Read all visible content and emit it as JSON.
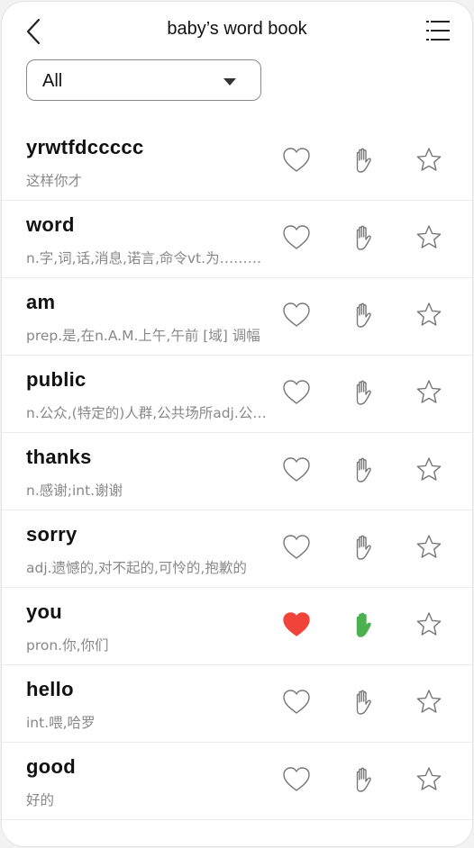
{
  "header": {
    "title": "baby’s word book",
    "back_icon": "chevron-left-icon",
    "menu_icon": "list-menu-icon"
  },
  "filter": {
    "selected": "All"
  },
  "colors": {
    "liked_heart": "#f2433b",
    "known_hand": "#4caf50",
    "outline": "#777777"
  },
  "words": [
    {
      "word": "yrwtfdccccc",
      "meaning": "这样你才",
      "liked": false,
      "known": false,
      "starred": false
    },
    {
      "word": "word",
      "meaning": "n.字,词,话,消息,诺言,命令vt.为……措辞",
      "liked": false,
      "known": false,
      "starred": false
    },
    {
      "word": "am",
      "meaning": "prep.是,在n.A.M.上午,午前 [域] 调幅",
      "liked": false,
      "known": false,
      "starred": false
    },
    {
      "word": "public",
      "meaning": "n.公众,(特定的)人群,公共场所adj.公共的",
      "liked": false,
      "known": false,
      "starred": false
    },
    {
      "word": "thanks",
      "meaning": "n.感谢;int.谢谢",
      "liked": false,
      "known": false,
      "starred": false
    },
    {
      "word": "sorry",
      "meaning": "adj.遗憾的,对不起的,可怜的,抱歉的",
      "liked": false,
      "known": false,
      "starred": false
    },
    {
      "word": "you",
      "meaning": " pron.你,你们",
      "liked": true,
      "known": true,
      "starred": false
    },
    {
      "word": "hello",
      "meaning": "int.喂,哈罗",
      "liked": false,
      "known": false,
      "starred": false
    },
    {
      "word": "good",
      "meaning": "好的",
      "liked": false,
      "known": false,
      "starred": false
    }
  ]
}
